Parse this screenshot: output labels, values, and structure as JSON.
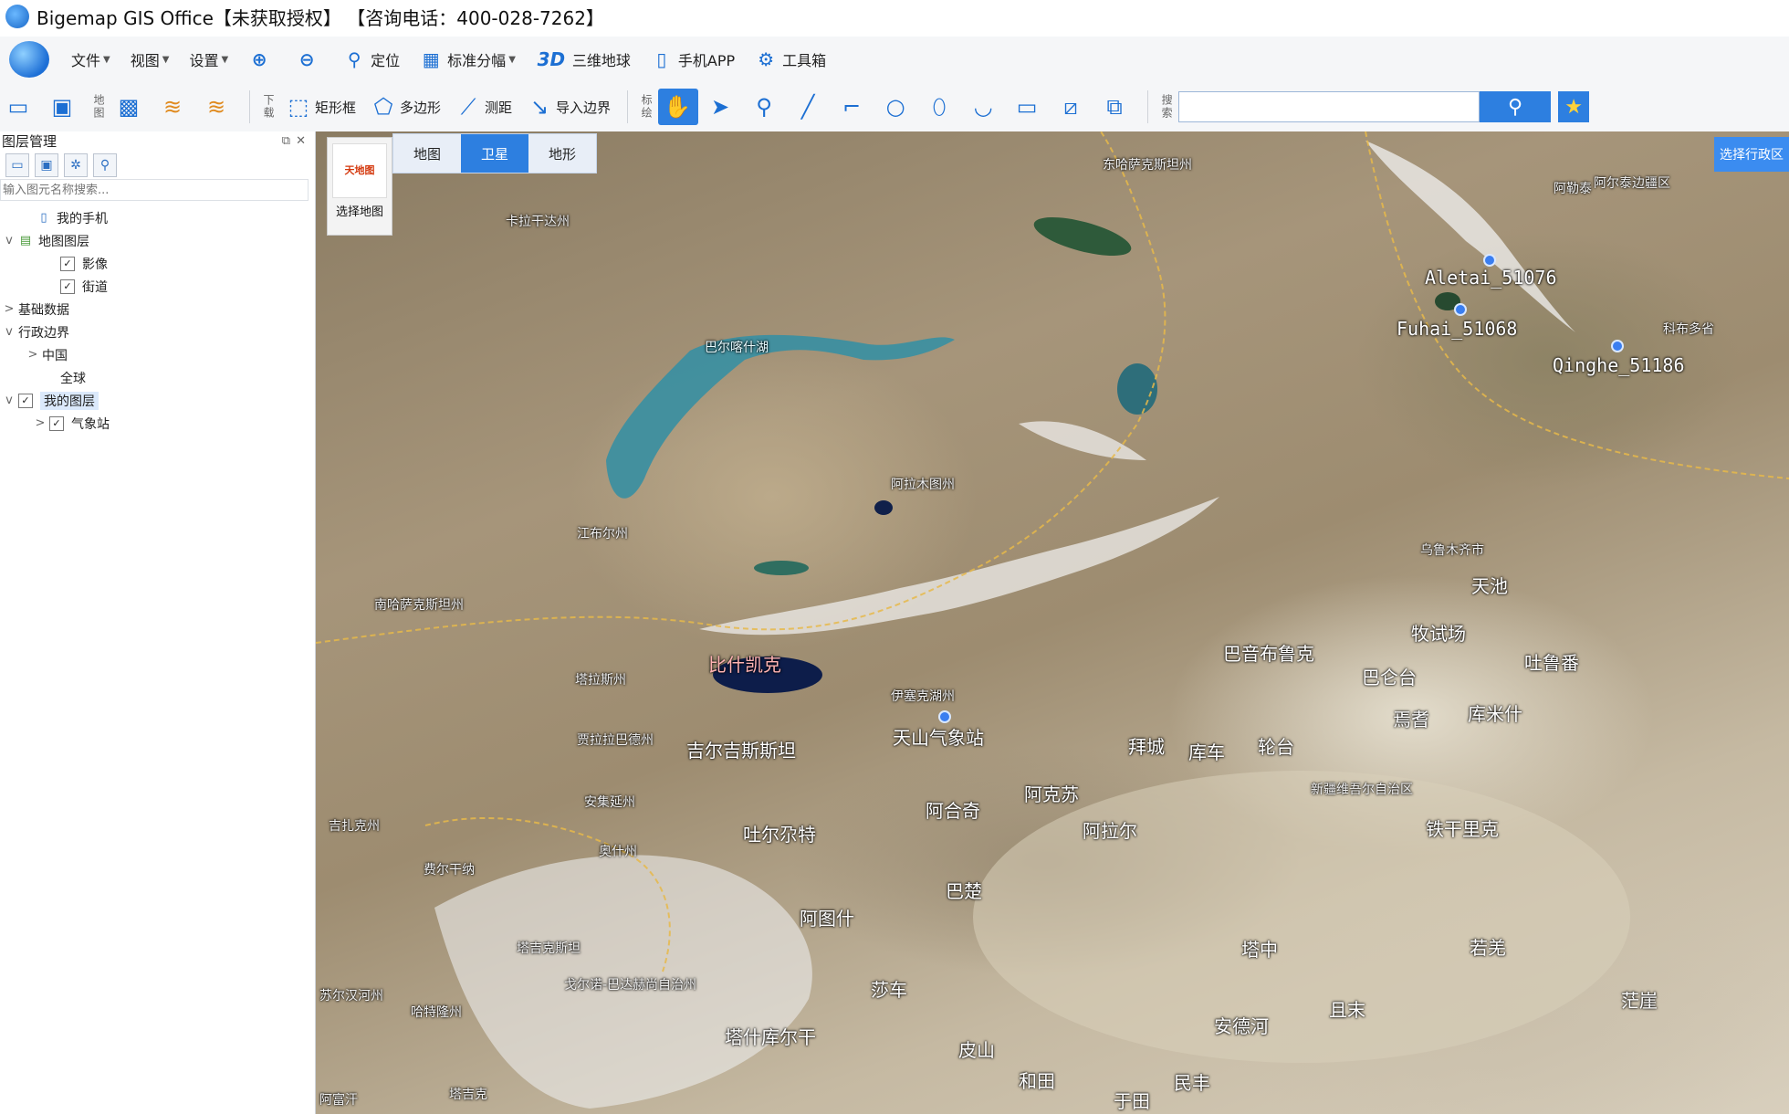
{
  "window": {
    "title": "Bigemap GIS Office【未获取授权】 【咨询电话：400-028-7262】"
  },
  "menu": [
    {
      "label": "文件",
      "dropdown": true,
      "icon": ""
    },
    {
      "label": "视图",
      "dropdown": true,
      "icon": ""
    },
    {
      "label": "设置",
      "dropdown": true,
      "icon": ""
    },
    {
      "label": "",
      "icon": "zoom-in-icon"
    },
    {
      "label": "",
      "icon": "zoom-out-icon"
    },
    {
      "label": "定位",
      "icon": "location-pin-icon"
    },
    {
      "label": "标准分幅",
      "dropdown": true,
      "icon": "grid-icon"
    },
    {
      "label": "三维地球",
      "icon": "3d-icon"
    },
    {
      "label": "手机APP",
      "icon": "phone-icon"
    },
    {
      "label": "工具箱",
      "icon": "gear-icon"
    }
  ],
  "toolbar": {
    "map_group_label": "地图",
    "download_group_label": "下载",
    "download_tools": [
      "矩形框",
      "多边形",
      "测距",
      "导入边界"
    ],
    "draw_group_label": "标绘",
    "search_group_label": "搜索",
    "search_placeholder": ""
  },
  "sidebar": {
    "title": "图层管理",
    "search_placeholder": "输入图元名称搜索...",
    "tree": [
      {
        "label": "我的手机",
        "level": 1,
        "expand": "",
        "checkbox": false,
        "icon": "phone-icon"
      },
      {
        "label": "地图图层",
        "level": 0,
        "expand": "v",
        "checkbox": false,
        "icon": "map-layer-icon"
      },
      {
        "label": "影像",
        "level": 2,
        "expand": "",
        "checkbox": true
      },
      {
        "label": "街道",
        "level": 2,
        "expand": "",
        "checkbox": true
      },
      {
        "label": "基础数据",
        "level": 0,
        "expand": ">",
        "checkbox": false
      },
      {
        "label": "行政边界",
        "level": 0,
        "expand": "v",
        "checkbox": false
      },
      {
        "label": "中国",
        "level": 1,
        "expand": ">",
        "checkbox": false
      },
      {
        "label": "全球",
        "level": 1,
        "expand": "",
        "checkbox": false
      },
      {
        "label": "我的图层",
        "level": 0,
        "expand": "v",
        "checkbox": true,
        "selected": true
      },
      {
        "label": "气象站",
        "level": 1,
        "expand": ">",
        "checkbox": true
      }
    ]
  },
  "map": {
    "tabs": [
      {
        "label": "地图"
      },
      {
        "label": "卫星",
        "active": true
      },
      {
        "label": "地形"
      }
    ],
    "select_label": "选择地图",
    "select_logo": "天地图",
    "region_button": "选择行政区",
    "stations": [
      {
        "label": "Aletai_51076"
      },
      {
        "label": "Fuhai_51068"
      },
      {
        "label": "Qinghe_51186"
      },
      {
        "label": "天山气象站"
      }
    ],
    "places": [
      "东哈萨克斯坦州",
      "卡拉干达州",
      "阿尔泰边疆区",
      "阿勒泰",
      "科布多省",
      "阿拉木图州",
      "江布尔州",
      "乌鲁木齐市",
      "天池",
      "南哈萨克斯坦州",
      "牧试场",
      "巴音布鲁克",
      "巴仑台",
      "吐鲁番",
      "塔拉斯州",
      "比什凯克",
      "伊塞克湖州",
      "焉耆",
      "库米什",
      "贾拉拉巴德州",
      "吉尔吉斯斯坦",
      "拜城",
      "库车",
      "轮台",
      "新疆维吾尔自治区",
      "阿合奇",
      "阿克苏",
      "阿拉尔",
      "铁干里克",
      "吉扎克州",
      "安集延州",
      "吐尔尕特",
      "奥什州",
      "巴楚",
      "费尔干纳",
      "阿图什",
      "塔中",
      "若羌",
      "塔吉克斯坦",
      "戈尔诺-巴达赫尚自治州",
      "苏尔汉河州",
      "哈特隆州",
      "莎车",
      "安德河",
      "且末",
      "茫崖",
      "塔什库尔干",
      "皮山",
      "和田",
      "于田",
      "民丰",
      "塔吉克",
      "巴尔喀什湖",
      "阿富汗"
    ]
  }
}
